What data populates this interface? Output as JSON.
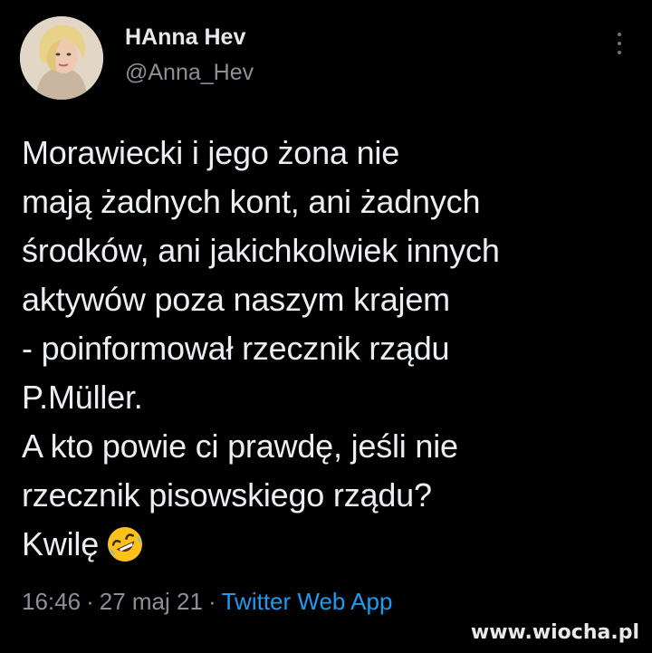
{
  "author": {
    "display_name": "HAnna Hev",
    "handle": "@Anna_Hev"
  },
  "tweet": {
    "lines": [
      "Morawiecki i jego żona nie",
      "mają żadnych kont, ani żadnych",
      "środków, ani jakichkolwiek innych",
      "aktywów poza naszym krajem",
      "- poinformował rzecznik rządu",
      "P.Müller.",
      "A kto powie ci prawdę, jeśli nie",
      "rzecznik pisowskiego rządu?",
      "Kwilę"
    ],
    "emoji": "rolling-on-the-floor-laughing"
  },
  "meta": {
    "time": "16:46",
    "separator": "·",
    "date": "27 maj 21",
    "source": "Twitter Web App"
  },
  "watermark": "www.wiocha.pl",
  "colors": {
    "background": "#000000",
    "text": "#e7e9ea",
    "secondary": "#8b9096",
    "link": "#1d9bf0"
  },
  "icons": {
    "more": "more-vertical-icon",
    "emoji": "rofl-emoji-icon"
  }
}
